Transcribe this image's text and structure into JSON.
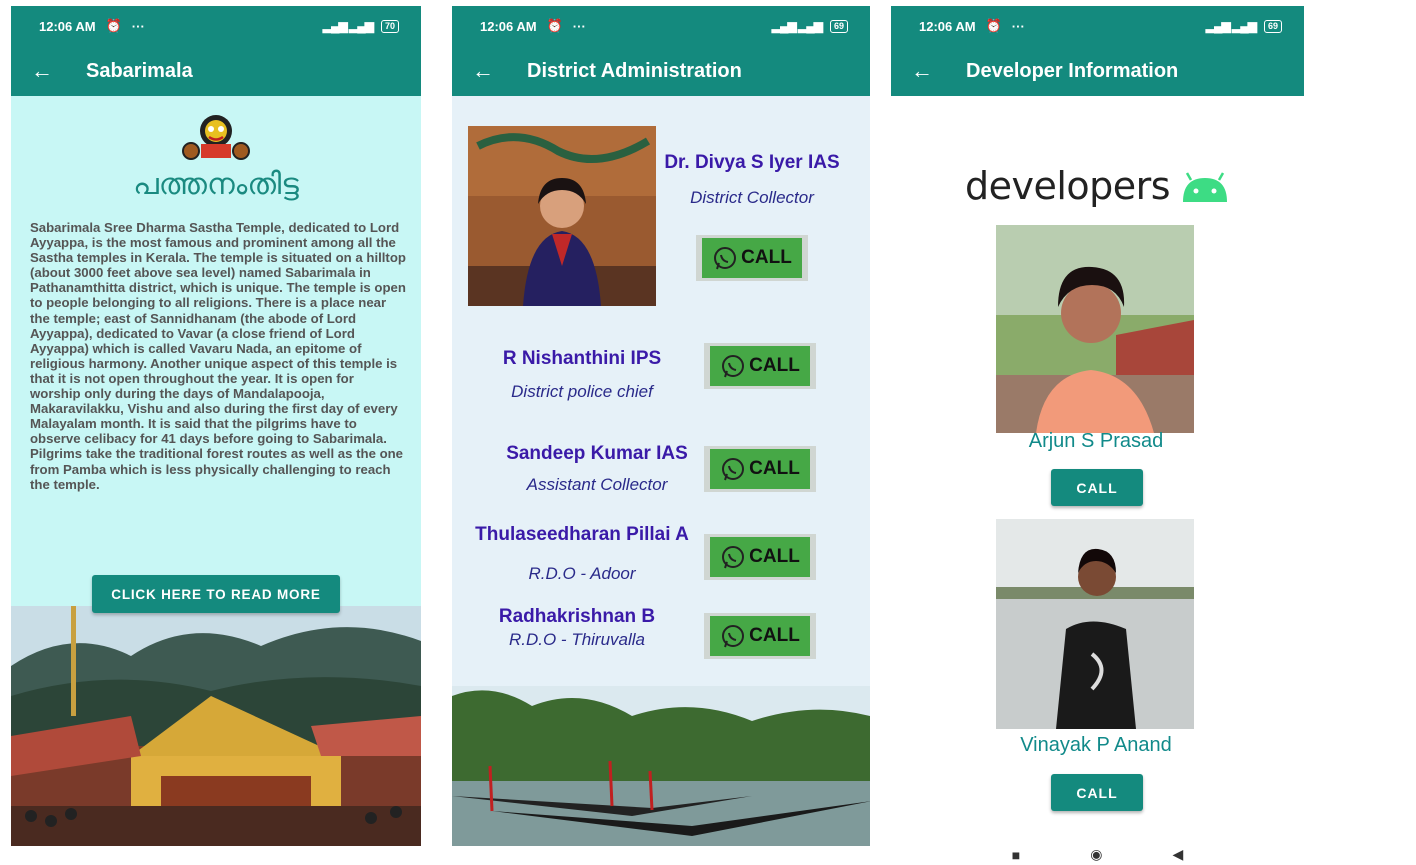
{
  "status": {
    "time": "12:06 AM",
    "more": "···",
    "battery_1": "70",
    "battery_2": "69",
    "battery_3": "69"
  },
  "screen1": {
    "title": "Sabarimala",
    "logo_text": "പത്തനംതിട്ട",
    "description": "Sabarimala Sree Dharma Sastha Temple, dedicated to Lord Ayyappa, is the most famous and prominent among all the Sastha temples in Kerala. The temple is situated on a hilltop (about 3000 feet above sea level) named Sabarimala in Pathanamthitta district, which is unique. The temple is open to people belonging to all religions. There is a place near the temple; east of Sannidhanam (the abode of Lord Ayyappa), dedicated to Vavar (a close friend of Lord Ayyappa) which is called Vavaru Nada, an epitome of religious harmony. Another unique aspect of this temple is that it is not open throughout the year. It is open for worship only during the days of Mandalapooja, Makaravilakku, Vishu and also during the first day of every Malayalam month. It is said that the pilgrims have to observe celibacy for 41 days before going to Sabarimala. Pilgrims take the traditional forest routes as well as the one from Pamba which is less physically challenging to reach the temple.",
    "read_more": "CLICK HERE TO READ MORE"
  },
  "screen2": {
    "title": "District Administration",
    "call_label": "CALL",
    "officials": [
      {
        "name": "Dr. Divya S Iyer IAS",
        "role": "District Collector"
      },
      {
        "name": "R Nishanthini IPS",
        "role": "District police chief"
      },
      {
        "name": "Sandeep Kumar IAS",
        "role": "Assistant Collector"
      },
      {
        "name": "Thulaseedharan Pillai A",
        "role": "R.D.O - Adoor"
      },
      {
        "name": "Radhakrishnan B",
        "role": "R.D.O - Thiruvalla"
      }
    ]
  },
  "screen3": {
    "title": "Developer Information",
    "developers_word": "developers",
    "call_label": "CALL",
    "devs": [
      {
        "name": "Arjun S Prasad"
      },
      {
        "name": "Vinayak P Anand"
      }
    ]
  },
  "icons": [
    "back-arrow-icon",
    "alarm-icon",
    "telegram-icon",
    "call-icon",
    "whatsapp-icon",
    "android-icon",
    "nav-recent-icon",
    "nav-home-icon",
    "nav-back-icon"
  ]
}
